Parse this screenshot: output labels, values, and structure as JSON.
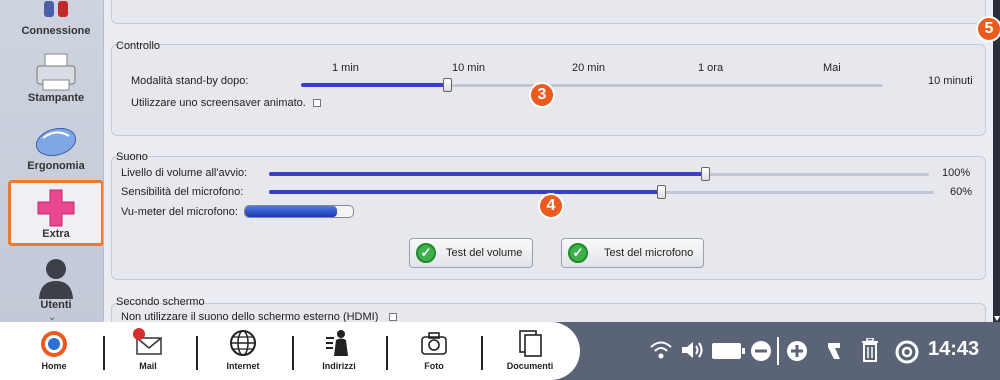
{
  "sidebar": {
    "items": [
      {
        "label": "Connessione",
        "icon": "connection-icon"
      },
      {
        "label": "Stampante",
        "icon": "printer-icon"
      },
      {
        "label": "Ergonomia",
        "icon": "mouse-icon"
      },
      {
        "label": "Extra",
        "icon": "plus-icon"
      },
      {
        "label": "Utenti",
        "icon": "user-icon"
      }
    ],
    "selected": "Extra",
    "more": "⌄"
  },
  "controllo": {
    "title": "Controllo",
    "standby_label": "Modalità stand-by dopo:",
    "ticks": [
      "1 min",
      "10 min",
      "20 min",
      "1 ora",
      "Mai"
    ],
    "standby_value": "10 minuti",
    "standby_level": 0.25,
    "screensaver_label": "Utilizzare uno screensaver animato."
  },
  "suono": {
    "title": "Suono",
    "volume_label": "Livello di volume all'avvio:",
    "volume_value": "100%",
    "volume_level": 0.66,
    "mic_label": "Sensibilità del microfono:",
    "mic_value": "60%",
    "mic_level": 0.59,
    "vumeter_label": "Vu-meter del microfono:",
    "vumeter_level": 0.85,
    "test_volume": "Test del volume",
    "test_mic": "Test del microfono"
  },
  "secondo_schermo": {
    "title": "Secondo schermo",
    "hdmi_label": "Non utilizzare il suono dello schermo esterno (HDMI)"
  },
  "badges": [
    "3",
    "4",
    "5"
  ],
  "taskbar": {
    "items": [
      {
        "label": "Home",
        "icon": "home-icon"
      },
      {
        "label": "Mail",
        "icon": "mail-icon"
      },
      {
        "label": "Internet",
        "icon": "globe-icon"
      },
      {
        "label": "Indirizzi",
        "icon": "contacts-icon"
      },
      {
        "label": "Foto",
        "icon": "camera-icon"
      },
      {
        "label": "Documenti",
        "icon": "documents-icon"
      }
    ],
    "clock": "14:43"
  },
  "colors": {
    "accent": "#f07a2c",
    "slider": "#3b3dcb",
    "badge": "#ea5b1d",
    "taskbar": "#5b6477"
  }
}
